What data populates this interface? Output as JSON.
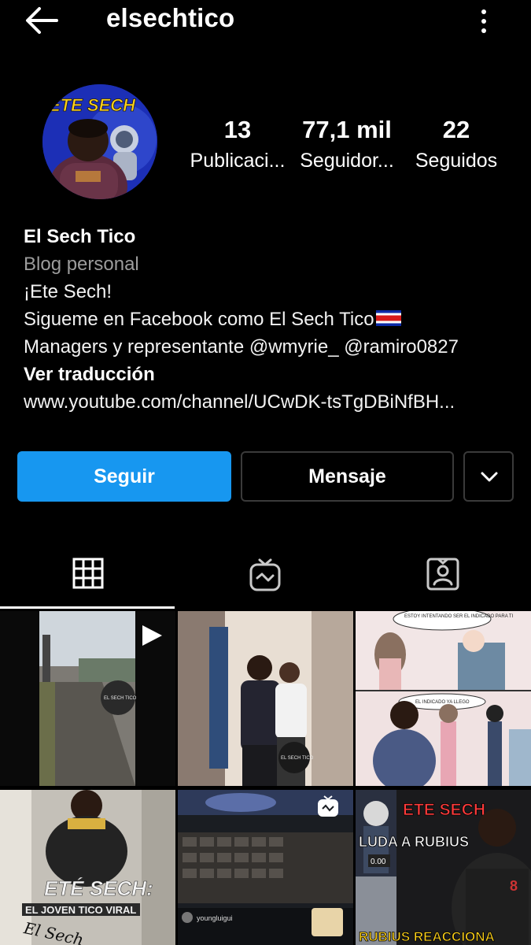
{
  "header": {
    "username": "elsechtico"
  },
  "profile": {
    "avatar_text": "ETE SECH",
    "stats": {
      "posts_count": "13",
      "posts_label": "Publicaci...",
      "followers_count": "77,1 mil",
      "followers_label": "Seguidor...",
      "following_count": "22",
      "following_label": "Seguidos"
    },
    "name": "El Sech Tico",
    "category": "Blog personal",
    "bio_line1": "¡Ete Sech!",
    "bio_line2": "Sigueme en Facebook como El Sech Tico",
    "bio_line3": "Managers y representante @wmyrie_ @ramiro0827",
    "translate_label": "Ver traducción",
    "website": "www.youtube.com/channel/UCwDK-tsTgDBiNfBH..."
  },
  "actions": {
    "follow_label": "Seguir",
    "message_label": "Mensaje"
  },
  "tabs": [
    {
      "name": "grid",
      "icon": "grid-icon",
      "active": true
    },
    {
      "name": "igtv",
      "icon": "igtv-icon",
      "active": false
    },
    {
      "name": "tagged",
      "icon": "tagged-icon",
      "active": false
    }
  ],
  "posts": {
    "post1_watermark": "EL SECH TICO",
    "post2_watermark": "EL SECH TICO",
    "post3_top_caption": "ESTOY INTENTANDO SER EL INDICADO PARA TI",
    "post3_mid_caption": "EL INDICADO YA LLEGO",
    "post4_headline": "ETÉ SECH:",
    "post4_subhead": "EL JOVEN TICO VIRAL",
    "post4_signature": "El Sech",
    "post5_comment_user": "youngluigui",
    "post6_title": "ETE SECH",
    "post6_line2": "LUDA A RUBIUS",
    "post6_line3": "RUBIUS REACCIONA",
    "post6_timer": "0.00"
  },
  "colors": {
    "background": "#000000",
    "follow_button": "#1797f0",
    "border": "#3a3a3a",
    "secondary_text": "#9c9c9c"
  }
}
